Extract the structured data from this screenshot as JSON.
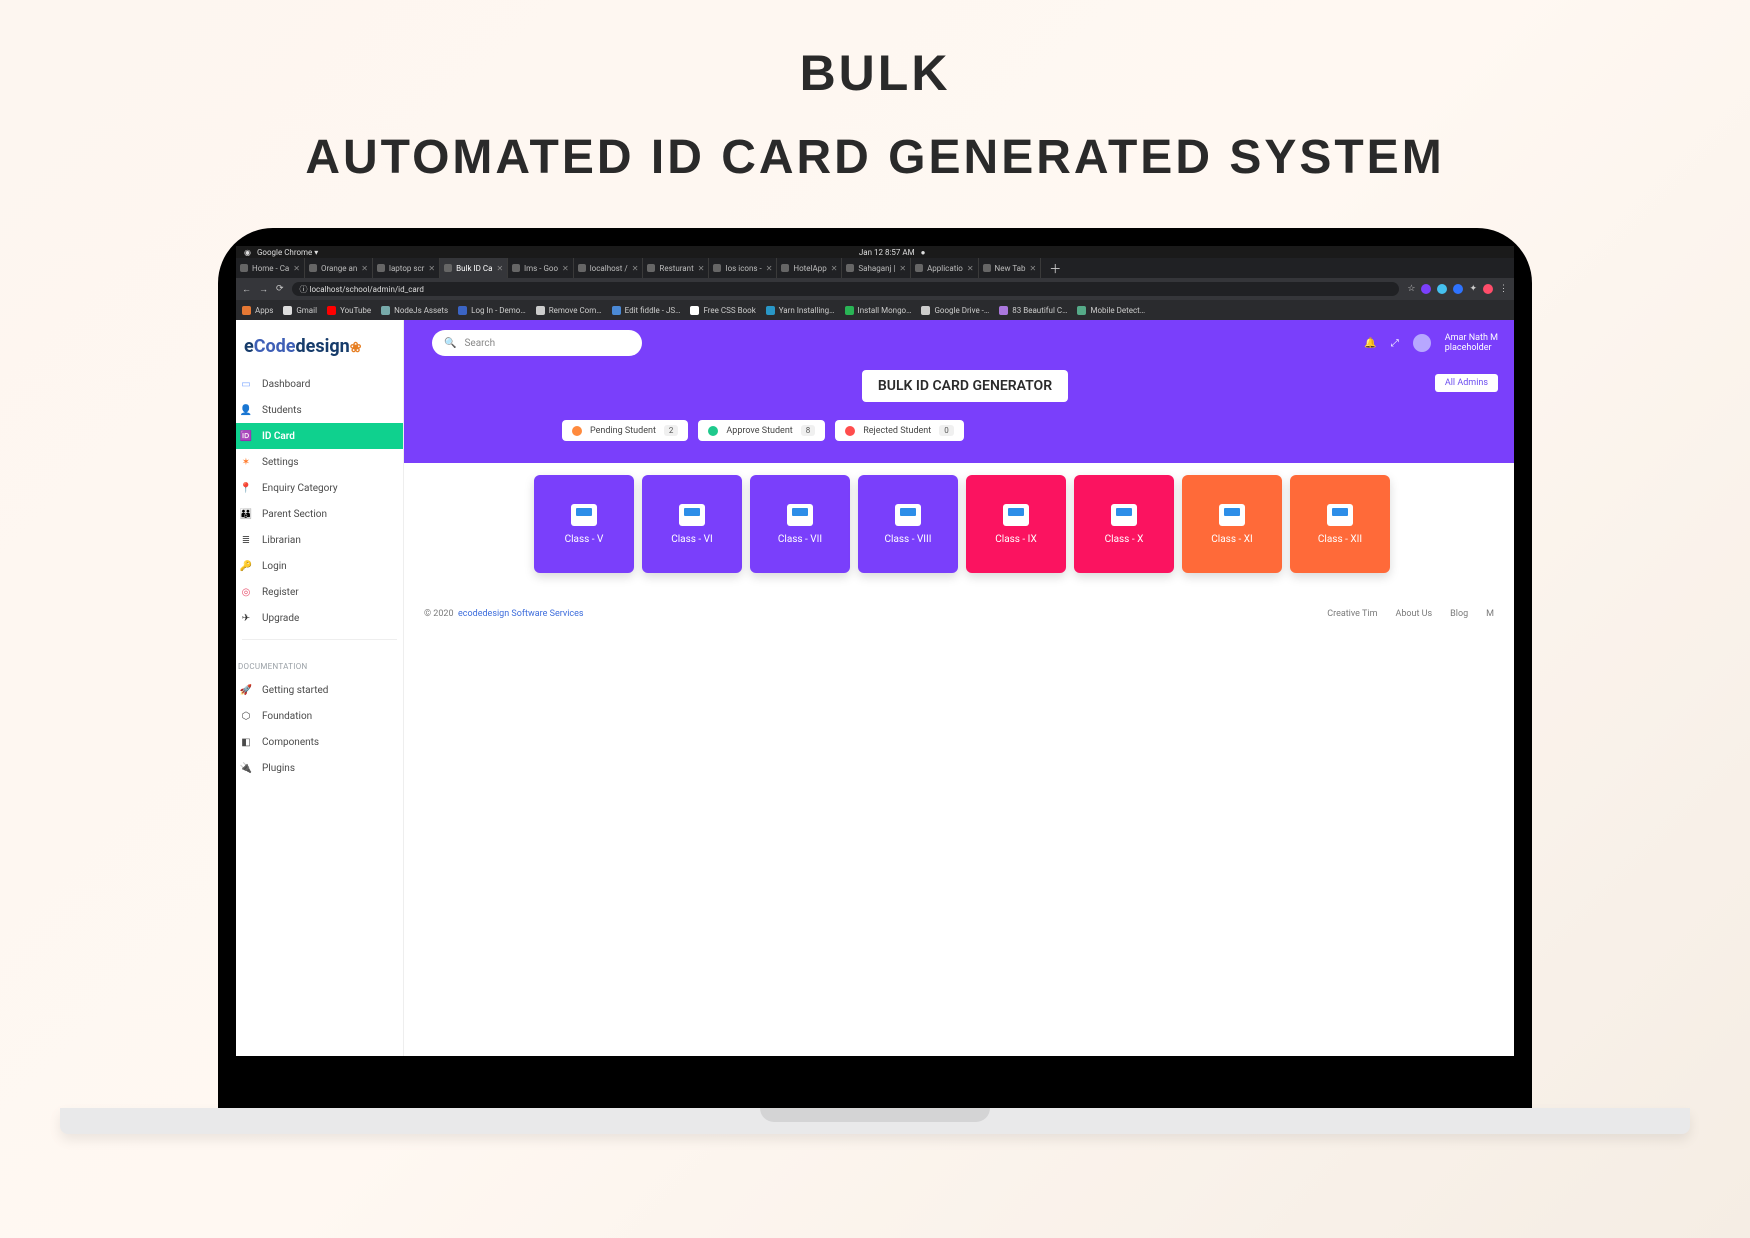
{
  "hero": {
    "line1": "BULK",
    "line2": "AUTOMATED ID CARD GENERATED SYSTEM"
  },
  "os": {
    "app": "Google Chrome ▾",
    "datetime": "Jan 12  8:57 AM",
    "dot": "●"
  },
  "tabs": [
    {
      "label": "Home - Ca"
    },
    {
      "label": "Orange an"
    },
    {
      "label": "laptop scr"
    },
    {
      "label": "Bulk ID Ca",
      "active": true
    },
    {
      "label": "lms - Goo"
    },
    {
      "label": "localhost /"
    },
    {
      "label": "Resturant"
    },
    {
      "label": "Ios icons -"
    },
    {
      "label": "HotelApp"
    },
    {
      "label": "Sahaganj |"
    },
    {
      "label": "Applicatio"
    },
    {
      "label": "New Tab"
    }
  ],
  "url": "localhost/school/admin/id_card",
  "bookmarks": [
    {
      "label": "Apps",
      "color": "#e57834"
    },
    {
      "label": "Gmail",
      "color": "#ddd"
    },
    {
      "label": "YouTube",
      "color": "#ff0000"
    },
    {
      "label": "NodeJs Assets",
      "color": "#7aa"
    },
    {
      "label": "Log In - Demo…",
      "color": "#3b64c4"
    },
    {
      "label": "Remove Com…",
      "color": "#ccc"
    },
    {
      "label": "Edit fiddle - JS…",
      "color": "#4b89d6"
    },
    {
      "label": "Free CSS Book",
      "color": "#fff"
    },
    {
      "label": "Yarn Installing…",
      "color": "#2997c7"
    },
    {
      "label": "Install Mongo…",
      "color": "#29b455"
    },
    {
      "label": "Google Drive -…",
      "color": "#ccc"
    },
    {
      "label": "83 Beautiful C…",
      "color": "#a7d"
    },
    {
      "label": "Mobile Detect…",
      "color": "#5a8"
    }
  ],
  "logo": {
    "pre": "e",
    "mid": "Code",
    "post": "design"
  },
  "nav": [
    {
      "icon": "▭",
      "label": "Dashboard",
      "color": "#7aa6ff"
    },
    {
      "icon": "👤",
      "label": "Students",
      "color": "#2cc5b9"
    },
    {
      "icon": "🆔",
      "label": "ID Card",
      "active": true,
      "color": "#e34"
    },
    {
      "icon": "✶",
      "label": "Settings",
      "color": "#ff7a2a"
    },
    {
      "icon": "📍",
      "label": "Enquiry Category",
      "color": "#6c4df0"
    },
    {
      "icon": "👪",
      "label": "Parent Section",
      "color": "#f6c945"
    },
    {
      "icon": "≣",
      "label": "Librarian",
      "color": "#555"
    },
    {
      "icon": "🔑",
      "label": "Login",
      "color": "#2cc5b9"
    },
    {
      "icon": "◎",
      "label": "Register",
      "color": "#e84d6a"
    },
    {
      "icon": "✈",
      "label": "Upgrade",
      "color": "#333"
    }
  ],
  "doc_header": "DOCUMENTATION",
  "doc_items": [
    {
      "icon": "🚀",
      "label": "Getting started"
    },
    {
      "icon": "⬡",
      "label": "Foundation"
    },
    {
      "icon": "◧",
      "label": "Components"
    },
    {
      "icon": "🔌",
      "label": "Plugins"
    }
  ],
  "search": {
    "placeholder": "Search"
  },
  "topbar_right": {
    "bell": "🔔",
    "expand": "⤢",
    "username": "Amar Nath M",
    "subtext": "placeholder"
  },
  "page_title": "BULK ID CARD GENERATOR",
  "all_admins": "All Admins",
  "statuses": [
    {
      "icon_color": "#ff8a3d",
      "label": "Pending Student",
      "count": "2"
    },
    {
      "icon_color": "#1ec98c",
      "label": "Approve Student",
      "count": "8"
    },
    {
      "icon_color": "#ff4d4d",
      "label": "Rejected Student",
      "count": "0"
    }
  ],
  "classes": [
    {
      "label": "Class - V",
      "color": "c-purple"
    },
    {
      "label": "Class - VI",
      "color": "c-purple"
    },
    {
      "label": "Class - VII",
      "color": "c-purple"
    },
    {
      "label": "Class - VIII",
      "color": "c-purple"
    },
    {
      "label": "Class - IX",
      "color": "c-pink"
    },
    {
      "label": "Class - X",
      "color": "c-pink"
    },
    {
      "label": "Class - XI",
      "color": "c-orange"
    },
    {
      "label": "Class - XII",
      "color": "c-orange"
    }
  ],
  "footer": {
    "copyright": "© 2020",
    "company": "ecodedesign Software Services",
    "links": [
      "Creative Tim",
      "About Us",
      "Blog",
      "M"
    ]
  }
}
